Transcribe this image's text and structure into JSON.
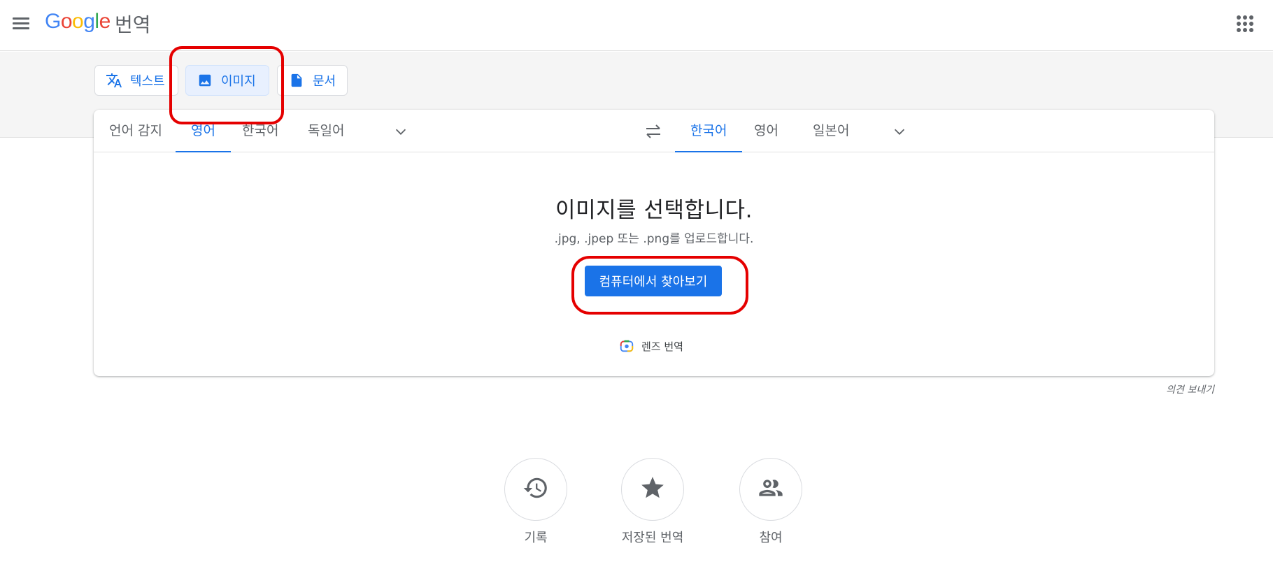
{
  "header": {
    "logo_letters": [
      "G",
      "o",
      "o",
      "g",
      "l",
      "e"
    ],
    "product_name": "번역",
    "menu_icon": "hamburger-menu-icon",
    "apps_icon": "apps-grid-icon"
  },
  "mode_tabs": [
    {
      "label": "텍스트",
      "icon": "translate-icon",
      "active": false
    },
    {
      "label": "이미지",
      "icon": "image-icon",
      "active": true
    },
    {
      "label": "문서",
      "icon": "document-icon",
      "active": false
    }
  ],
  "source_languages": [
    "언어 감지",
    "영어",
    "한국어",
    "독일어"
  ],
  "source_selected": "영어",
  "target_languages": [
    "한국어",
    "영어",
    "일본어"
  ],
  "target_selected": "한국어",
  "upload": {
    "title": "이미지를 선택합니다.",
    "subtitle": ".jpg, .jpep 또는 .png를 업로드합니다.",
    "browse_button": "컴퓨터에서 찾아보기",
    "lens_label": "렌즈 번역"
  },
  "feedback": "의견 보내기",
  "bottom_actions": [
    {
      "label": "기록",
      "icon": "history-icon"
    },
    {
      "label": "저장된 번역",
      "icon": "star-icon"
    },
    {
      "label": "참여",
      "icon": "community-icon"
    }
  ],
  "colors": {
    "accent": "#1a73e8",
    "annotation": "#e50000"
  }
}
